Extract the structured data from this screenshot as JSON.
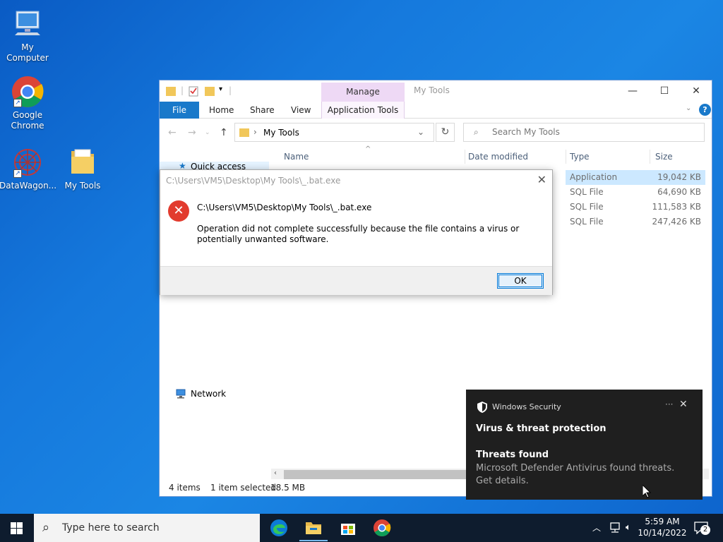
{
  "desktop": {
    "icons": [
      {
        "label": "My Computer",
        "icon": "computer-icon"
      },
      {
        "label": "Google Chrome",
        "icon": "chrome-icon"
      },
      {
        "label": "DataWagon...",
        "icon": "datawagon-icon"
      },
      {
        "label": "My Tools",
        "icon": "folder-icon"
      }
    ]
  },
  "explorer": {
    "title": "My Tools",
    "manage_tab": "Manage",
    "tabs": {
      "file": "File",
      "home": "Home",
      "share": "Share",
      "view": "View",
      "app_tools": "Application Tools"
    },
    "address": "My Tools",
    "search_placeholder": "Search My Tools",
    "columns": {
      "name": "Name",
      "date": "Date modified",
      "type": "Type",
      "size": "Size"
    },
    "rows": [
      {
        "type": "Application",
        "size": "19,042 KB",
        "selected": true
      },
      {
        "type": "SQL File",
        "size": "64,690 KB",
        "selected": false
      },
      {
        "type": "SQL File",
        "size": "111,583 KB",
        "selected": false
      },
      {
        "type": "SQL File",
        "size": "247,426 KB",
        "selected": false
      }
    ],
    "nav": {
      "quick_access": "Quick access",
      "network": "Network"
    },
    "status": {
      "items": "4 items",
      "selected": "1 item selected",
      "size": "18.5 MB"
    }
  },
  "dialog": {
    "title": "C:\\Users\\VM5\\Desktop\\My Tools\\_.bat.exe",
    "path": "C:\\Users\\VM5\\Desktop\\My Tools\\_.bat.exe",
    "message": "Operation did not complete successfully because the file contains a virus or potentially unwanted software.",
    "ok": "OK"
  },
  "toast": {
    "app": "Windows Security",
    "more": "···",
    "heading": "Virus & threat protection",
    "subheading": "Threats found",
    "body": "Microsoft Defender Antivirus found threats. Get details."
  },
  "taskbar": {
    "search_placeholder": "Type here to search",
    "time": "5:59 AM",
    "date": "10/14/2022",
    "notification_count": "2"
  },
  "colors": {
    "accent": "#0078d7",
    "file_tab": "#1979ca",
    "manage_tab": "#eed9f5",
    "error": "#e23b2e",
    "toast_bg": "#1f1f1f",
    "taskbar_bg": "#0e1c2e"
  }
}
